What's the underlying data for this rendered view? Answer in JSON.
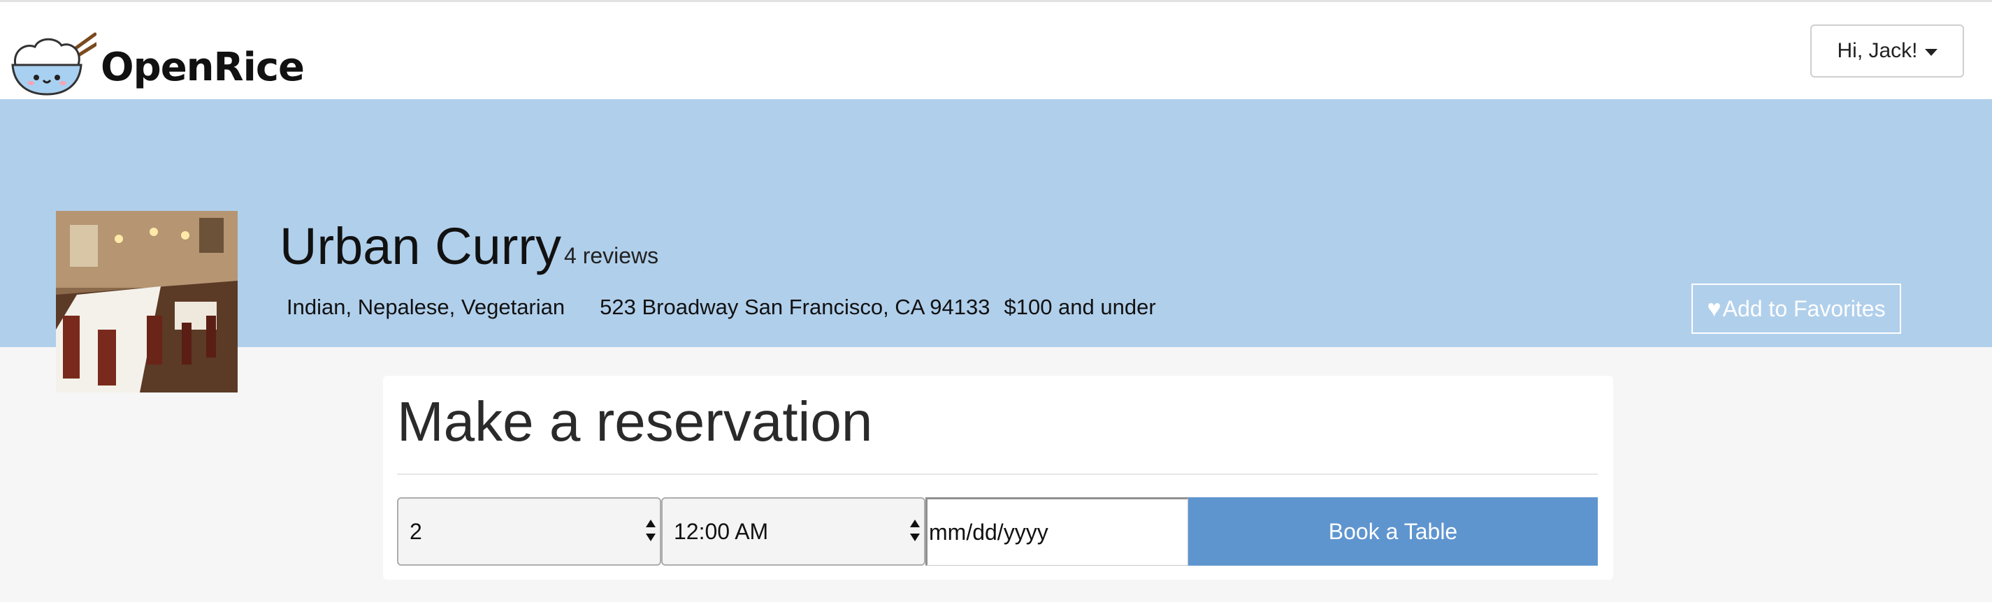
{
  "brand": {
    "name": "OpenRice"
  },
  "user_menu": {
    "label": "Hi, Jack!"
  },
  "restaurant": {
    "name": "Urban Curry",
    "review_count": "4 reviews",
    "cuisine": "Indian, Nepalese, Vegetarian",
    "address": "523 Broadway San Francisco, CA 94133",
    "price": "$100 and under",
    "favorite_label": "Add to Favorites"
  },
  "reservation": {
    "title": "Make a reservation",
    "party_size": "2",
    "time": "12:00 AM",
    "date_placeholder": "mm/dd/yyyy",
    "book_label": "Book a Table"
  },
  "colors": {
    "banner": "#b0cfeb",
    "book_button": "#5f95cf",
    "page_background": "#f6f6f6"
  },
  "icons": {
    "logo": "rice-bowl-icon",
    "favorite": "heart-icon",
    "user_menu": "caret-down-icon",
    "select": "updown-arrows-icon"
  }
}
